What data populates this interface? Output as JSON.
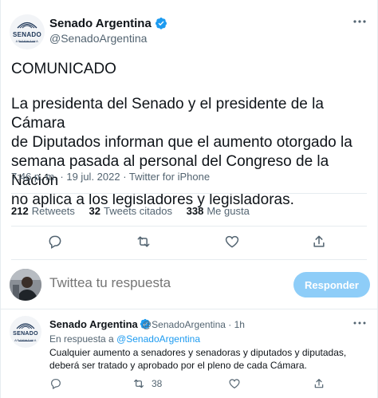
{
  "tweet": {
    "author_name": "Senado Argentina",
    "author_handle": "@SenadoArgentina",
    "logo_text": "SENADO",
    "logo_subtext": "ARGENTINA",
    "title": "COMUNICADO",
    "body": "La presidenta del Senado y el presidente de la Cámara\nde Diputados informan que el aumento otorgado la\nsemana pasada al personal del Congreso de la Nación\nno aplica a los legisladores y legisladoras.",
    "meta": "7:46 p. m. · 19 jul. 2022 · Twitter for iPhone",
    "stats": [
      {
        "value": "212",
        "label": "Retweets"
      },
      {
        "value": "32",
        "label": "Tweets citados"
      },
      {
        "value": "338",
        "label": "Me gusta"
      }
    ],
    "icons": [
      "verified-icon",
      "more-icon",
      "reply-icon",
      "retweet-icon",
      "like-icon",
      "share-icon"
    ]
  },
  "composer": {
    "placeholder": "Twittea tu respuesta",
    "button_label": "Responder"
  },
  "reply": {
    "author_name": "Senado Argentina",
    "author_handle_time": "@SenadoArgentina · 1h",
    "logo_text": "SENADO",
    "logo_subtext": "ARGENTINA",
    "replying_prefix": "En respuesta a",
    "replying_to": "@SenadoArgentina",
    "text": "Cualquier aumento a senadores y senadoras y diputados y diputadas,\ndeberá ser tratado y aprobado por el pleno de cada Cámara.",
    "retweets": "38"
  },
  "colors": {
    "accent": "#1d9bf0",
    "button_disabled": "#8ecdf8",
    "secondary_text": "#536471",
    "divider": "#e6ecf0"
  }
}
